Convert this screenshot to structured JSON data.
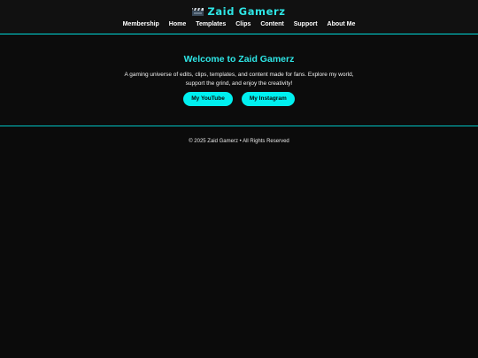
{
  "header": {
    "logo_icon": "film-clapper-icon",
    "title": "Zaid Gamerz",
    "nav": [
      "Membership",
      "Home",
      "Templates",
      "Clips",
      "Content",
      "Support",
      "About Me"
    ]
  },
  "hero": {
    "title": "Welcome to Zaid Gamerz",
    "text": "A gaming universe of edits, clips, templates, and content made for fans. Explore my world, support the grind, and enjoy the creativity!",
    "buttons": [
      "My YouTube",
      "My Instagram"
    ]
  },
  "footer": {
    "copyright": "© 2025 Zaid Gamerz • All Rights Reserved"
  },
  "colors": {
    "accent": "#00f0f0",
    "background": "#0b0b0b",
    "header_bg": "#111111"
  }
}
